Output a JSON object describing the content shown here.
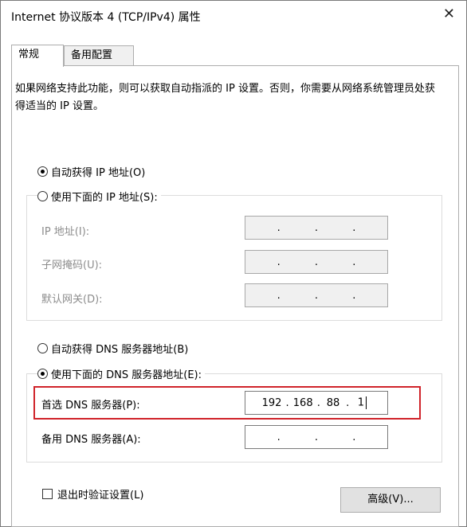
{
  "window": {
    "title": "Internet 协议版本 4 (TCP/IPv4) 属性",
    "close_glyph": "✕"
  },
  "tabs": [
    {
      "label": "常规"
    },
    {
      "label": "备用配置"
    }
  ],
  "description": "如果网络支持此功能，则可以获取自动指派的 IP 设置。否则，你需要从网络系统管理员处获得适当的 IP 设置。",
  "ip_section": {
    "auto_label": "自动获得 IP 地址(O)",
    "auto_selected": true,
    "manual_label": "使用下面的 IP 地址(S):",
    "manual_selected": false,
    "ip_label": "IP 地址(I):",
    "subnet_label": "子网掩码(U):",
    "gateway_label": "默认网关(D):",
    "ip_value": [
      ".",
      ".",
      "."
    ],
    "subnet_value": [
      ".",
      ".",
      "."
    ],
    "gateway_value": [
      ".",
      ".",
      "."
    ]
  },
  "dns_section": {
    "auto_label": "自动获得 DNS 服务器地址(B)",
    "auto_selected": false,
    "manual_label": "使用下面的 DNS 服务器地址(E):",
    "manual_selected": true,
    "preferred_label": "首选 DNS 服务器(P):",
    "preferred_value": [
      "192",
      "168",
      "88",
      "1"
    ],
    "alternate_label": "备用 DNS 服务器(A):",
    "alternate_value": [
      "",
      "",
      "",
      ""
    ],
    "separator": "."
  },
  "validate": {
    "label": "退出时验证设置(L)",
    "checked": false
  },
  "advanced_button": {
    "label": "高级(V)..."
  },
  "colors": {
    "highlight_border": "#d0232a",
    "disabled_text": "#8c8c8c"
  }
}
